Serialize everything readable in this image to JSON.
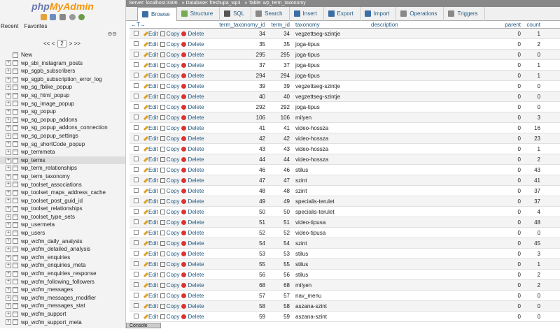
{
  "app": {
    "logo_php": "php",
    "logo_admin": "MyAdmin"
  },
  "nav": {
    "recent": "Recent",
    "favorites": "Favorites",
    "pager_prev": "<< <",
    "pager_value": "2",
    "pager_next": "> >>",
    "new_label": "New"
  },
  "tables": [
    "wp_sbi_instagram_posts",
    "wp_sgpb_subscribers",
    "wp_sgpb_subscription_error_log",
    "wp_sg_fblike_popup",
    "wp_sg_html_popup",
    "wp_sg_image_popup",
    "wp_sg_popup",
    "wp_sg_popup_addons",
    "wp_sg_popup_addons_connection",
    "wp_sg_popup_settings",
    "wp_sg_shortCode_popup",
    "wp_termmeta",
    "wp_terms",
    "wp_term_relationships",
    "wp_term_taxonomy",
    "wp_toolset_associations",
    "wp_toolset_maps_address_cache",
    "wp_toolset_post_guid_id",
    "wp_toolset_relationships",
    "wp_toolset_type_sets",
    "wp_usermeta",
    "wp_users",
    "wp_wcfm_daily_analysis",
    "wp_wcfm_detailed_analysis",
    "wp_wcfm_enquiries",
    "wp_wcfm_enquiries_meta",
    "wp_wcfm_enquiries_response",
    "wp_wcfm_following_followers",
    "wp_wcfm_messages",
    "wp_wcfm_messages_modifier",
    "wp_wcfm_messages_stat",
    "wp_wcfm_support",
    "wp_wcfm_support_meta"
  ],
  "breadcrumb": {
    "server": "Server: localhost:3306",
    "database": "Database: freshupa_wp3",
    "table": "Table: wp_term_taxonomy"
  },
  "tabs": [
    "Browse",
    "Structure",
    "SQL",
    "Search",
    "Insert",
    "Export",
    "Import",
    "Operations",
    "Triggers"
  ],
  "columns": {
    "taxid": "term_taxonomy_id",
    "tid": "term_id",
    "tax": "taxonomy",
    "desc": "description",
    "parent": "parent",
    "count": "count"
  },
  "actions": {
    "edit": "Edit",
    "copy": "Copy",
    "delete": "Delete"
  },
  "rows": [
    [
      "34",
      "34",
      "vegzettseg-szintje",
      "0",
      "1"
    ],
    [
      "35",
      "35",
      "joga-tipus",
      "0",
      "2"
    ],
    [
      "295",
      "295",
      "joga-tipus",
      "0",
      "0"
    ],
    [
      "37",
      "37",
      "joga-tipus",
      "0",
      "1"
    ],
    [
      "294",
      "294",
      "joga-tipus",
      "0",
      "1"
    ],
    [
      "39",
      "39",
      "vegzettseg-szintje",
      "0",
      "0"
    ],
    [
      "40",
      "40",
      "vegzettseg-szintje",
      "0",
      "0"
    ],
    [
      "292",
      "292",
      "joga-tipus",
      "0",
      "0"
    ],
    [
      "106",
      "106",
      "milyen",
      "0",
      "3"
    ],
    [
      "41",
      "41",
      "video-hossza",
      "0",
      "16"
    ],
    [
      "42",
      "42",
      "video-hossza",
      "0",
      "23"
    ],
    [
      "43",
      "43",
      "video-hossza",
      "0",
      "1"
    ],
    [
      "44",
      "44",
      "video-hossza",
      "0",
      "2"
    ],
    [
      "46",
      "46",
      "stilus",
      "0",
      "43"
    ],
    [
      "47",
      "47",
      "szint",
      "0",
      "41"
    ],
    [
      "48",
      "48",
      "szint",
      "0",
      "37"
    ],
    [
      "49",
      "49",
      "specialis-terulet",
      "0",
      "37"
    ],
    [
      "50",
      "50",
      "specialis-terulet",
      "0",
      "4"
    ],
    [
      "51",
      "51",
      "video-tipusa",
      "0",
      "48"
    ],
    [
      "52",
      "52",
      "video-tipusa",
      "0",
      "0"
    ],
    [
      "54",
      "54",
      "szint",
      "0",
      "45"
    ],
    [
      "53",
      "53",
      "stilus",
      "0",
      "3"
    ],
    [
      "55",
      "55",
      "stilus",
      "0",
      "1"
    ],
    [
      "56",
      "56",
      "stilus",
      "0",
      "2"
    ],
    [
      "68",
      "68",
      "milyen",
      "0",
      "2"
    ],
    [
      "57",
      "57",
      "nav_menu",
      "0",
      "0"
    ],
    [
      "58",
      "58",
      "aszana-szint",
      "0",
      "0"
    ],
    [
      "59",
      "59",
      "aszana-szint",
      "0",
      "0"
    ]
  ],
  "console": "Console"
}
